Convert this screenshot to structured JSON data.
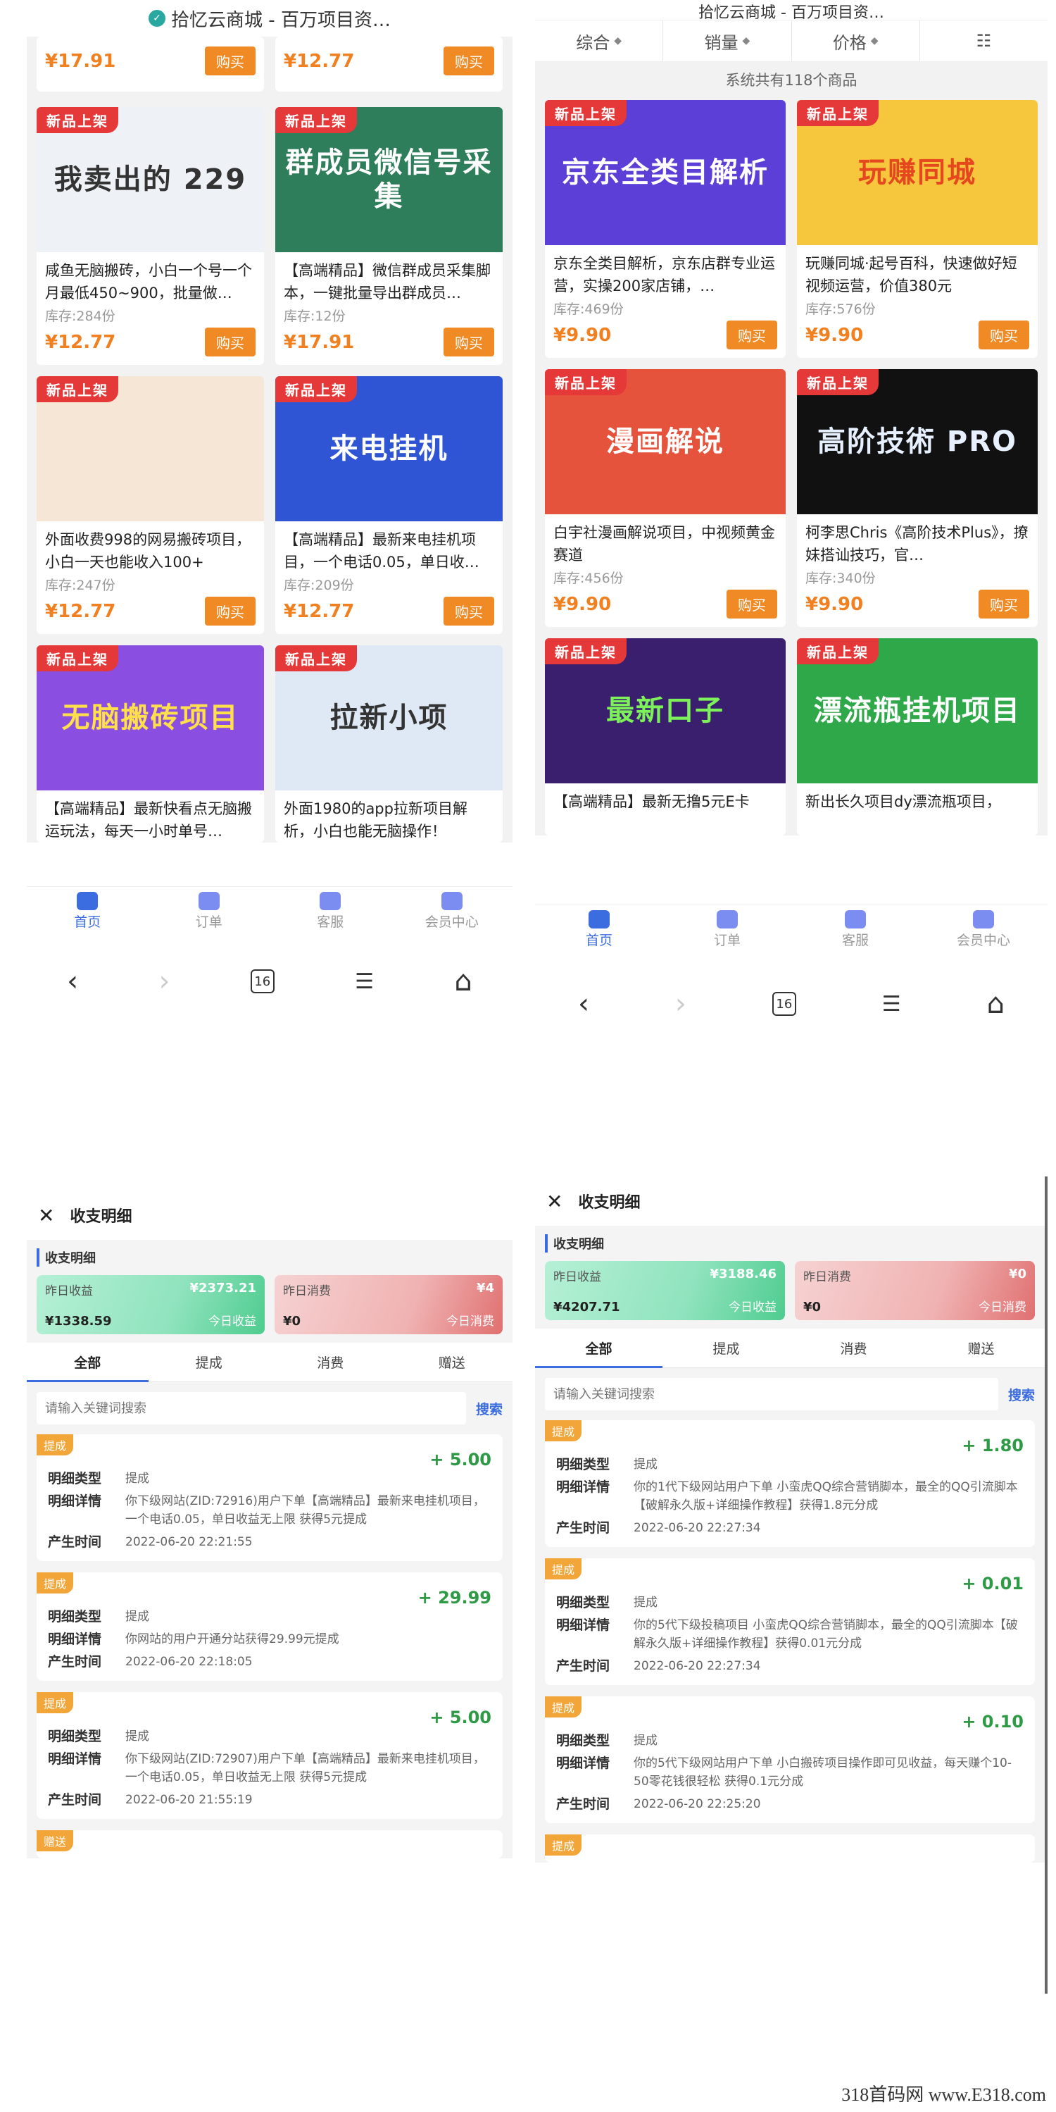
{
  "shop_left": {
    "title": "拾忆云商城 - 百万项目资…",
    "top_prices": [
      "¥17.91",
      "¥12.77"
    ],
    "buy_label": "购买",
    "new_badge": "新品上架",
    "products": [
      {
        "thumb": "我卖出的 229",
        "title": "咸鱼无脑搬砖，小白一个号一个月最低450~900，批量做…",
        "stock": "库存:284份",
        "price": "¥12.77",
        "color": "#eef1f6",
        "text_color": "#333333"
      },
      {
        "thumb": "群成员微信号采集",
        "title": "【高端精品】微信群成员采集脚本，一键批量导出群成员…",
        "stock": "库存:12份",
        "price": "¥17.91",
        "color": "#2e7d5b",
        "text_color": "#ffffff"
      },
      {
        "thumb": "",
        "title": "外面收费998的网易搬砖项目，小白一天也能收入100+",
        "stock": "库存:247份",
        "price": "¥12.77",
        "color": "#f5e6d6",
        "text_color": "#333333"
      },
      {
        "thumb": "来电挂机",
        "title": "【高端精品】最新来电挂机项目，一个电话0.05，单日收…",
        "stock": "库存:209份",
        "price": "¥12.77",
        "color": "#2f55d4",
        "text_color": "#ffffff"
      },
      {
        "thumb": "无脑搬砖项目",
        "title": "【高端精品】最新快看点无脑搬运玩法，每天一小时单号…",
        "stock": "",
        "price": "",
        "color": "#8a4fe0",
        "text_color": "#ffe04a"
      },
      {
        "thumb": "拉新小项",
        "title": "外面1980的app拉新项目解析，小白也能无脑操作！",
        "stock": "",
        "price": "",
        "color": "#dfe8f5",
        "text_color": "#333333"
      }
    ],
    "tabs": [
      "首页",
      "订单",
      "客服",
      "会员中心"
    ],
    "browser": {
      "back": "‹",
      "forward": "›",
      "tab_count": "16",
      "menu": "☰",
      "home": "⌂"
    }
  },
  "shop_right": {
    "title": "拾忆云商城 - 百万项目资…",
    "sort": [
      "综合",
      "销量",
      "价格"
    ],
    "sort_list_icon": "☷",
    "summary": "系统共有118个商品",
    "buy_label": "购买",
    "new_badge": "新品上架",
    "products": [
      {
        "thumb": "京东全类目解析",
        "title": "京东全类目解析，京东店群专业运营，实操200家店铺，…",
        "stock": "库存:469份",
        "price": "¥9.90",
        "color": "#5b3fd6",
        "text_color": "#ffffff"
      },
      {
        "thumb": "玩赚同城",
        "title": "玩赚同城·起号百科，快速做好短视频运营，价值380元",
        "stock": "库存:576份",
        "price": "¥9.90",
        "color": "#f6c63c",
        "text_color": "#e5471f"
      },
      {
        "thumb": "漫画解说",
        "title": "白宇社漫画解说项目，中视频黄金赛道",
        "stock": "库存:456份",
        "price": "¥9.90",
        "color": "#e5533d",
        "text_color": "#ffffff"
      },
      {
        "thumb": "高阶技術 PRO",
        "title": "柯李思Chris《高阶技术Plus》，撩妹搭讪技巧，官…",
        "stock": "库存:340份",
        "price": "¥9.90",
        "color": "#111111",
        "text_color": "#e6f0ff"
      },
      {
        "thumb": "最新口子",
        "title": "【高端精品】最新无撸5元E卡",
        "stock": "",
        "price": "",
        "color": "#3a1f6e",
        "text_color": "#7cf15a"
      },
      {
        "thumb": "漂流瓶挂机项目",
        "title": "新出长久项目dy漂流瓶项目，",
        "stock": "",
        "price": "",
        "color": "#2fa84a",
        "text_color": "#ffffff"
      }
    ],
    "tabs": [
      "首页",
      "订单",
      "客服",
      "会员中心"
    ],
    "browser": {
      "back": "‹",
      "forward": "›",
      "tab_count": "16",
      "menu": "☰",
      "home": "⌂"
    }
  },
  "fin_left": {
    "close": "✕",
    "title": "收支明细",
    "section": "收支明细",
    "yest_income_label": "昨日收益",
    "yest_income": "¥2373.21",
    "today_income": "¥1338.59",
    "today_income_label": "今日收益",
    "yest_spend_label": "昨日消费",
    "yest_spend": "¥4",
    "today_spend": "¥0",
    "today_spend_label": "今日消费",
    "tabs": [
      "全部",
      "提成",
      "消费",
      "赠送"
    ],
    "search_placeholder": "请输入关键词搜索",
    "search_btn": "搜索",
    "k_type": "明细类型",
    "k_detail": "明细详情",
    "k_time": "产生时间",
    "records": [
      {
        "badge": "提成",
        "amount": "+ 5.00",
        "type": "提成",
        "detail": "你下级网站(ZID:72916)用户下单【高端精品】最新来电挂机项目，一个电话0.05，单日收益无上限 获得5元提成",
        "time": "2022-06-20 22:21:55"
      },
      {
        "badge": "提成",
        "amount": "+ 29.99",
        "type": "提成",
        "detail": "你网站的用户开通分站获得29.99元提成",
        "time": "2022-06-20 22:18:05"
      },
      {
        "badge": "提成",
        "amount": "+ 5.00",
        "type": "提成",
        "detail": "你下级网站(ZID:72907)用户下单【高端精品】最新来电挂机项目，一个电话0.05，单日收益无上限 获得5元提成",
        "time": "2022-06-20 21:55:19"
      },
      {
        "badge": "赠送",
        "amount": "",
        "type": "",
        "detail": "",
        "time": ""
      }
    ]
  },
  "fin_right": {
    "close": "✕",
    "title": "收支明细",
    "section": "收支明细",
    "yest_income_label": "昨日收益",
    "yest_income": "¥3188.46",
    "today_income": "¥4207.71",
    "today_income_label": "今日收益",
    "yest_spend_label": "昨日消费",
    "yest_spend": "¥0",
    "today_spend": "¥0",
    "today_spend_label": "今日消费",
    "tabs": [
      "全部",
      "提成",
      "消费",
      "赠送"
    ],
    "search_placeholder": "请输入关键词搜索",
    "search_btn": "搜索",
    "k_type": "明细类型",
    "k_detail": "明细详情",
    "k_time": "产生时间",
    "records": [
      {
        "badge": "提成",
        "amount": "+ 1.80",
        "type": "提成",
        "detail": "你的1代下级网站用户下单 小蛮虎QQ综合营销脚本，最全的QQ引流脚本【破解永久版+详细操作教程】获得1.8元分成",
        "time": "2022-06-20 22:27:34"
      },
      {
        "badge": "提成",
        "amount": "+ 0.01",
        "type": "提成",
        "detail": "你的5代下级投稿项目 小蛮虎QQ综合营销脚本，最全的QQ引流脚本【破解永久版+详细操作教程】获得0.01元分成",
        "time": "2022-06-20 22:27:34"
      },
      {
        "badge": "提成",
        "amount": "+ 0.10",
        "type": "提成",
        "detail": "你的5代下级网站用户下单 小白搬砖项目操作即可见收益，每天赚个10-50零花钱很轻松 获得0.1元分成",
        "time": "2022-06-20 22:25:20"
      },
      {
        "badge": "提成",
        "amount": "",
        "type": "",
        "detail": "",
        "time": ""
      }
    ]
  },
  "watermark": "318首码网 www.E318.com"
}
